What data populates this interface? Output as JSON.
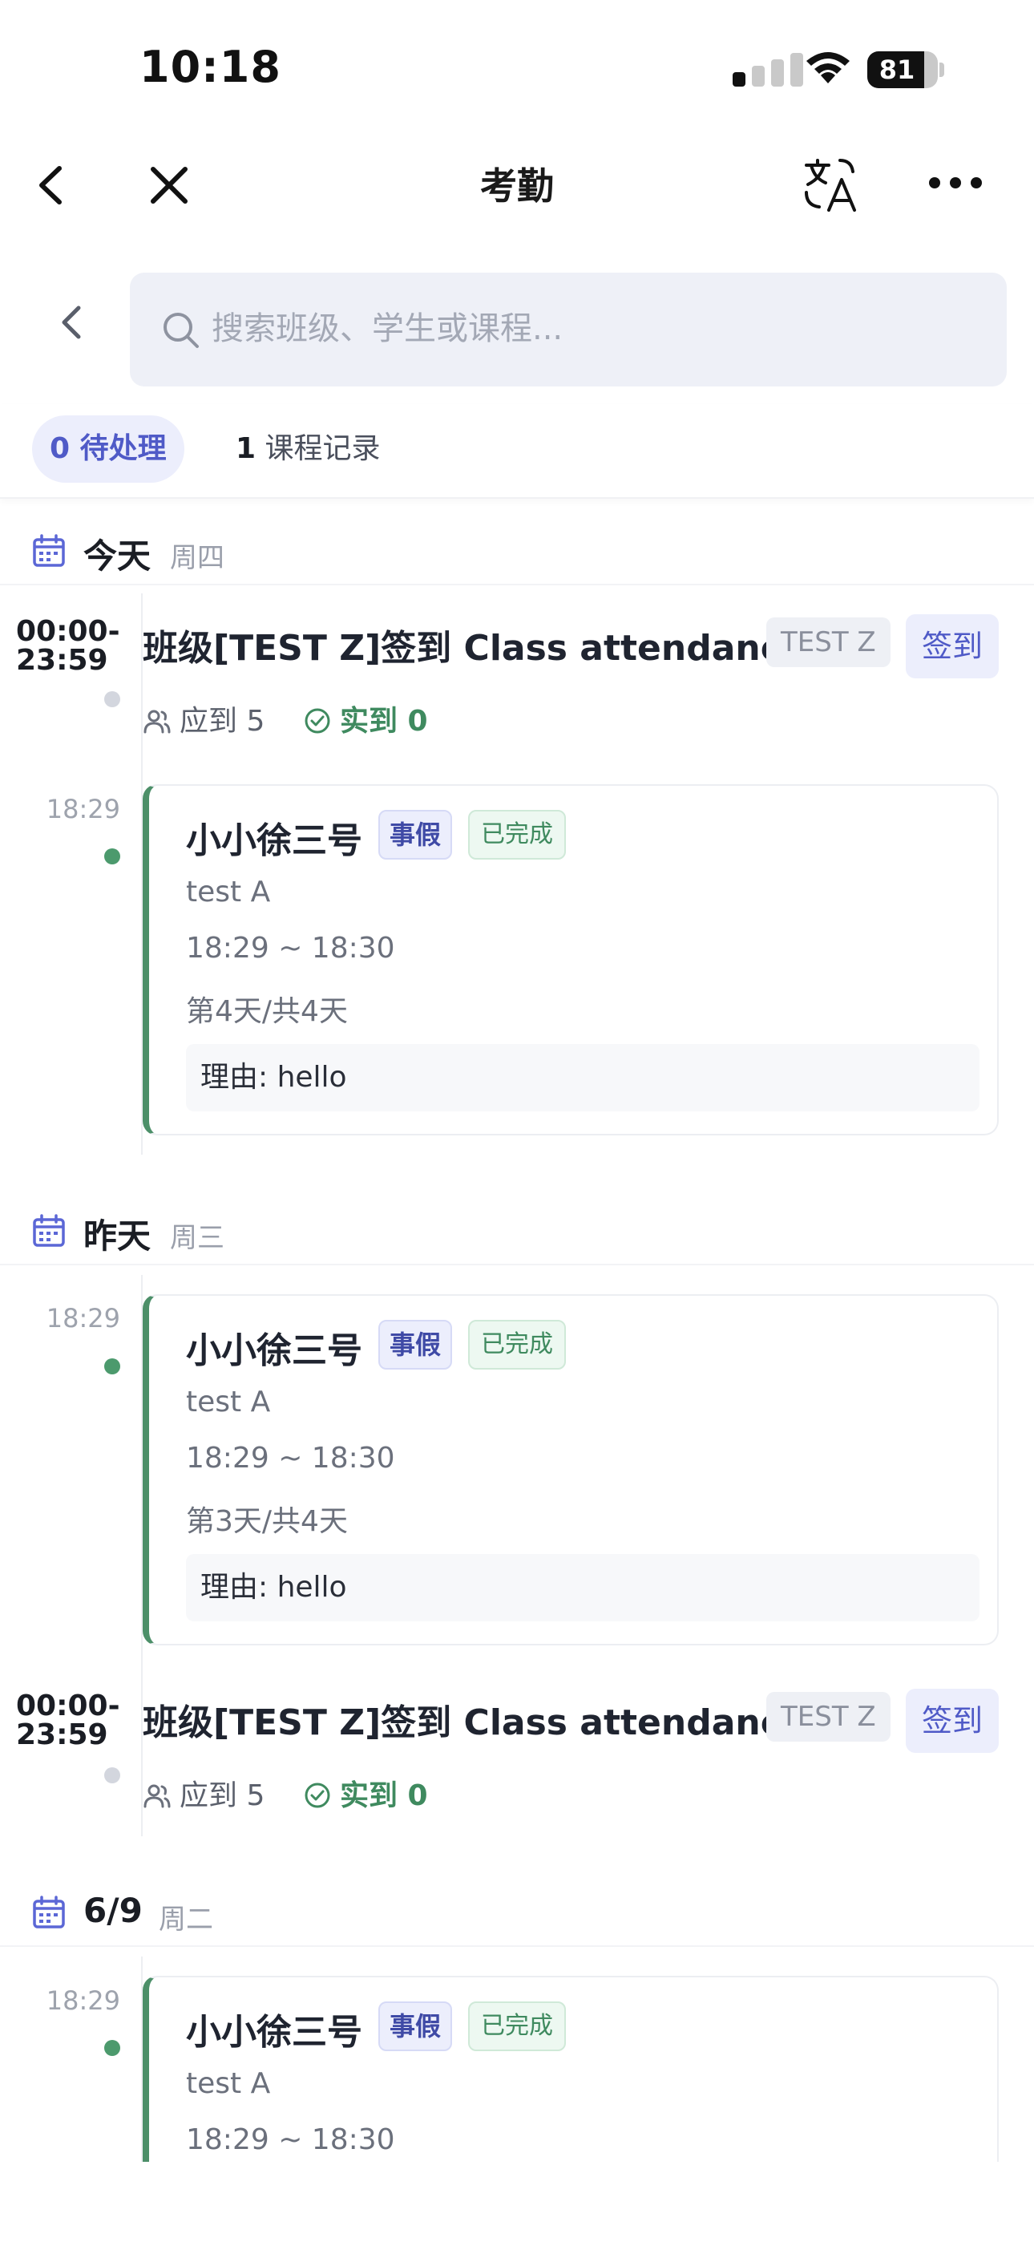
{
  "status_bar": {
    "time": "10:18",
    "battery": "81",
    "battery_level": 0.81
  },
  "nav": {
    "title": "考勤"
  },
  "search": {
    "placeholder": "搜索班级、学生或课程..."
  },
  "tabs": [
    {
      "count": "0",
      "label": "待处理",
      "active": true
    },
    {
      "count": "1",
      "label": "课程记录",
      "active": false
    }
  ],
  "days": [
    {
      "title": "今天",
      "weekday": "周四",
      "class_row": {
        "time": "00:00-23:59",
        "title": "班级[TEST Z]签到 Class attendance",
        "tag": "TEST Z",
        "button": "签到",
        "expected": "应到 5",
        "actual": "实到 0"
      },
      "leave": {
        "time": "18:29",
        "name": "小小徐三号",
        "type": "事假",
        "status": "已完成",
        "course": "test A",
        "time_range": "18:29 ~ 18:30",
        "days": "第4天/共4天",
        "reason": "理由: hello"
      }
    },
    {
      "title": "昨天",
      "weekday": "周三",
      "leave": {
        "time": "18:29",
        "name": "小小徐三号",
        "type": "事假",
        "status": "已完成",
        "course": "test A",
        "time_range": "18:29 ~ 18:30",
        "days": "第3天/共4天",
        "reason": "理由: hello"
      },
      "class_row": {
        "time": "00:00-23:59",
        "title": "班级[TEST Z]签到 Class attendance",
        "tag": "TEST Z",
        "button": "签到",
        "expected": "应到 5",
        "actual": "实到 0"
      }
    },
    {
      "title": "6/9",
      "weekday": "周二",
      "leave": {
        "time": "18:29",
        "name": "小小徐三号",
        "type": "事假",
        "status": "已完成",
        "course": "test A",
        "time_range": "18:29 ~ 18:30"
      }
    }
  ]
}
